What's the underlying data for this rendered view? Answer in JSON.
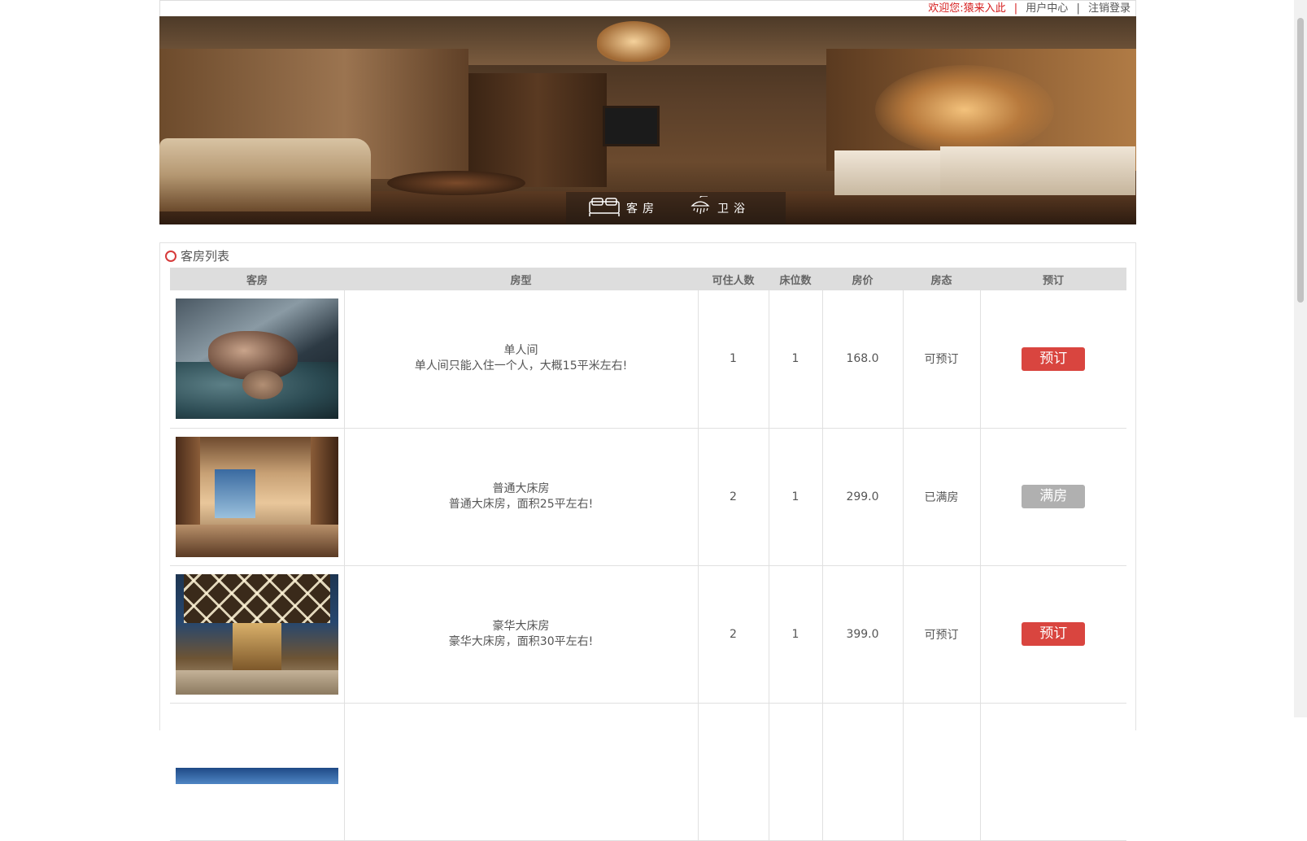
{
  "topbar": {
    "welcome": "欢迎您:",
    "username": "猿来入此",
    "separator": "|",
    "user_center": "用户中心",
    "logout": "注销登录"
  },
  "banner": {
    "tabs": [
      {
        "label": "客房",
        "icon": "bed-icon"
      },
      {
        "label": "卫浴",
        "icon": "shower-icon"
      }
    ]
  },
  "room_list": {
    "title": "客房列表",
    "columns": [
      "客房",
      "房型",
      "可住人数",
      "床位数",
      "房价",
      "房态",
      "预订"
    ],
    "rows": [
      {
        "image": "room-photo-single",
        "type_name": "单人间",
        "type_desc": "单人间只能入住一个人，大概15平米左右!",
        "capacity": "1",
        "beds": "1",
        "price": "168.0",
        "status": "可预订",
        "action": "预订",
        "available": true
      },
      {
        "image": "room-photo-standard-double",
        "type_name": "普通大床房",
        "type_desc": "普通大床房，面积25平左右!",
        "capacity": "2",
        "beds": "1",
        "price": "299.0",
        "status": "已满房",
        "action": "满房",
        "available": false
      },
      {
        "image": "room-photo-deluxe-double",
        "type_name": "豪华大床房",
        "type_desc": "豪华大床房，面积30平左右!",
        "capacity": "2",
        "beds": "1",
        "price": "399.0",
        "status": "可预订",
        "action": "预订",
        "available": true
      }
    ]
  },
  "colors": {
    "accent_red": "#d9453f",
    "disabled_gray": "#b0b0b0",
    "header_gray": "#dddddd",
    "welcome_red": "#d62020"
  }
}
